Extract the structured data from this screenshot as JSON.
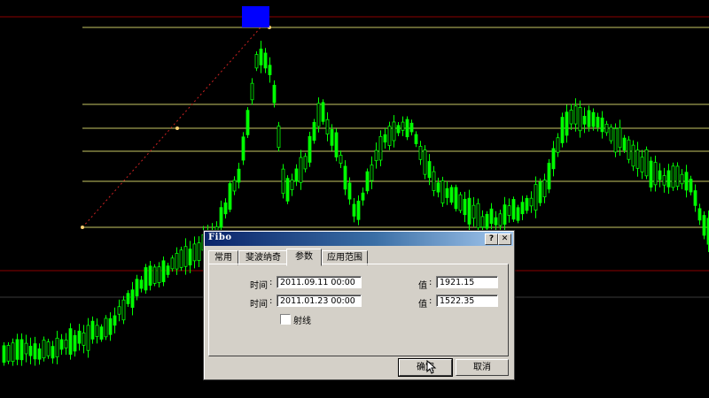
{
  "chart": {
    "background": "#000000",
    "candle_color": "#00ff00",
    "fibo_level_color": "#c8c864",
    "red_line_color": "#8b0000",
    "marker_color": "#0000ff"
  },
  "dialog": {
    "title": "Fibo",
    "help_label": "?",
    "close_label": "✕",
    "tabs": [
      "常用",
      "斐波纳奇",
      "参数",
      "应用范围"
    ],
    "active_tab": 2,
    "params": {
      "time1_label": "时间",
      "time1_value": "2011.09.11 00:00",
      "value1_label": "值",
      "value1": "1921.15",
      "time2_label": "时间",
      "time2_value": "2011.01.23 00:00",
      "value2_label": "值",
      "value2": "1522.35",
      "ray_label": "射线",
      "ray_checked": false
    },
    "ok_label": "确定",
    "cancel_label": "取消"
  }
}
